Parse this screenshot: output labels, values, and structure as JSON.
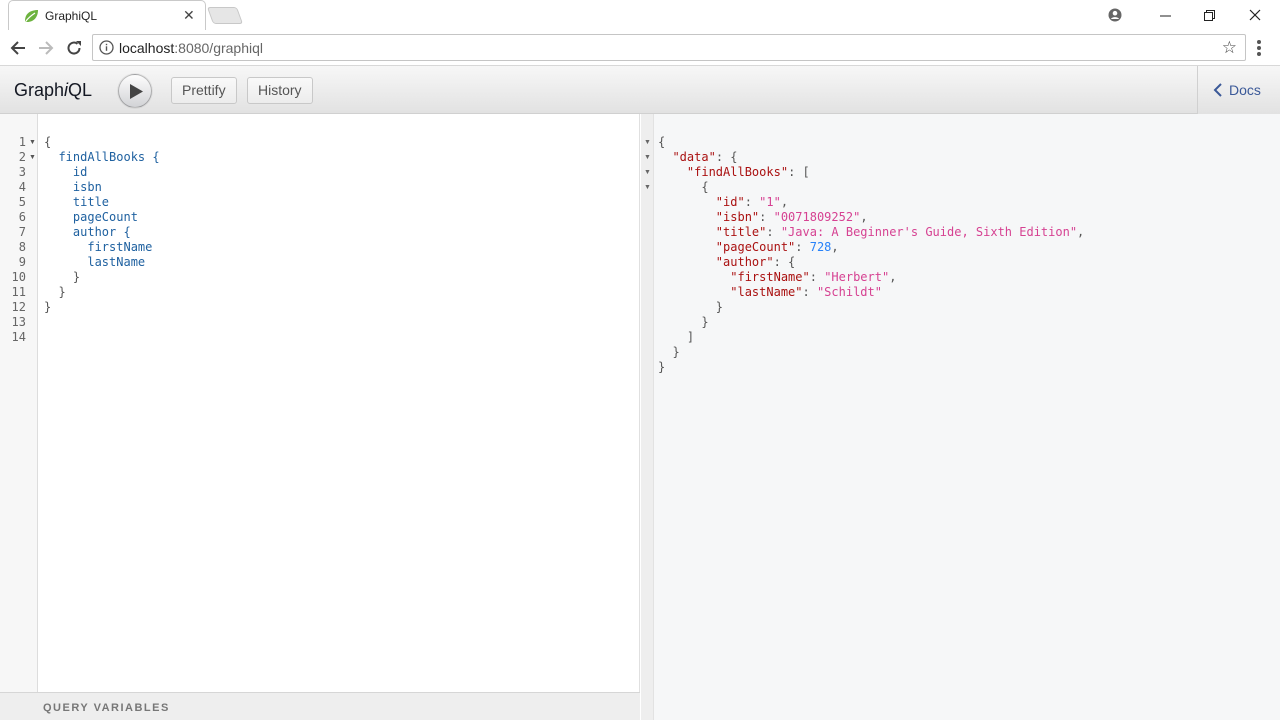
{
  "browser": {
    "tab_title": "GraphiQL",
    "tab_close": "✕",
    "url_host": "localhost",
    "url_rest": ":8080/graphiql",
    "window_minimize": "—",
    "window_restore": "❐",
    "window_close": "✕",
    "profile_icon": "account-circle-icon",
    "star_icon": "☆"
  },
  "graphiql": {
    "title_prefix": "Graph",
    "title_italic": "i",
    "title_suffix": "QL",
    "prettify_label": "Prettify",
    "history_label": "History",
    "docs_label": "Docs",
    "query_variables_label": "QUERY VARIABLES"
  },
  "query": {
    "line_numbers": [
      "1",
      "2",
      "3",
      "4",
      "5",
      "6",
      "7",
      "8",
      "9",
      "10",
      "11",
      "12",
      "13",
      "14"
    ],
    "lines": [
      {
        "indent": "",
        "text": "{"
      },
      {
        "indent": "  ",
        "text": "findAllBooks {"
      },
      {
        "indent": "    ",
        "text": "id"
      },
      {
        "indent": "    ",
        "text": "isbn"
      },
      {
        "indent": "    ",
        "text": "title"
      },
      {
        "indent": "    ",
        "text": "pageCount"
      },
      {
        "indent": "    ",
        "text": "author {"
      },
      {
        "indent": "      ",
        "text": "firstName"
      },
      {
        "indent": "      ",
        "text": "lastName"
      },
      {
        "indent": "    ",
        "text": "}"
      },
      {
        "indent": "  ",
        "text": "}"
      },
      {
        "indent": "",
        "text": "}"
      }
    ]
  },
  "result": {
    "lines": [
      {
        "indent": "",
        "parts": [
          [
            "p",
            "{"
          ]
        ]
      },
      {
        "indent": "  ",
        "parts": [
          [
            "k",
            "\"data\""
          ],
          [
            "p",
            ": {"
          ]
        ]
      },
      {
        "indent": "    ",
        "parts": [
          [
            "k",
            "\"findAllBooks\""
          ],
          [
            "p",
            ": ["
          ]
        ]
      },
      {
        "indent": "      ",
        "parts": [
          [
            "p",
            "{"
          ]
        ]
      },
      {
        "indent": "        ",
        "parts": [
          [
            "k",
            "\"id\""
          ],
          [
            "p",
            ": "
          ],
          [
            "s",
            "\"1\""
          ],
          [
            "p",
            ","
          ]
        ]
      },
      {
        "indent": "        ",
        "parts": [
          [
            "k",
            "\"isbn\""
          ],
          [
            "p",
            ": "
          ],
          [
            "s",
            "\"0071809252\""
          ],
          [
            "p",
            ","
          ]
        ]
      },
      {
        "indent": "        ",
        "parts": [
          [
            "k",
            "\"title\""
          ],
          [
            "p",
            ": "
          ],
          [
            "s",
            "\"Java: A Beginner's Guide, Sixth Edition\""
          ],
          [
            "p",
            ","
          ]
        ]
      },
      {
        "indent": "        ",
        "parts": [
          [
            "k",
            "\"pageCount\""
          ],
          [
            "p",
            ": "
          ],
          [
            "n",
            "728"
          ],
          [
            "p",
            ","
          ]
        ]
      },
      {
        "indent": "        ",
        "parts": [
          [
            "k",
            "\"author\""
          ],
          [
            "p",
            ": {"
          ]
        ]
      },
      {
        "indent": "          ",
        "parts": [
          [
            "k",
            "\"firstName\""
          ],
          [
            "p",
            ": "
          ],
          [
            "s",
            "\"Herbert\""
          ],
          [
            "p",
            ","
          ]
        ]
      },
      {
        "indent": "          ",
        "parts": [
          [
            "k",
            "\"lastName\""
          ],
          [
            "p",
            ": "
          ],
          [
            "s",
            "\"Schildt\""
          ]
        ]
      },
      {
        "indent": "        ",
        "parts": [
          [
            "p",
            "}"
          ]
        ]
      },
      {
        "indent": "      ",
        "parts": [
          [
            "p",
            "}"
          ]
        ]
      },
      {
        "indent": "    ",
        "parts": [
          [
            "p",
            "]"
          ]
        ]
      },
      {
        "indent": "  ",
        "parts": [
          [
            "p",
            "}"
          ]
        ]
      },
      {
        "indent": "",
        "parts": [
          [
            "p",
            "}"
          ]
        ]
      }
    ]
  },
  "colors": {
    "key": "#aa1111",
    "string": "#d64292",
    "number": "#2882f9",
    "field": "#1f61a0",
    "docs": "#3b5998"
  }
}
